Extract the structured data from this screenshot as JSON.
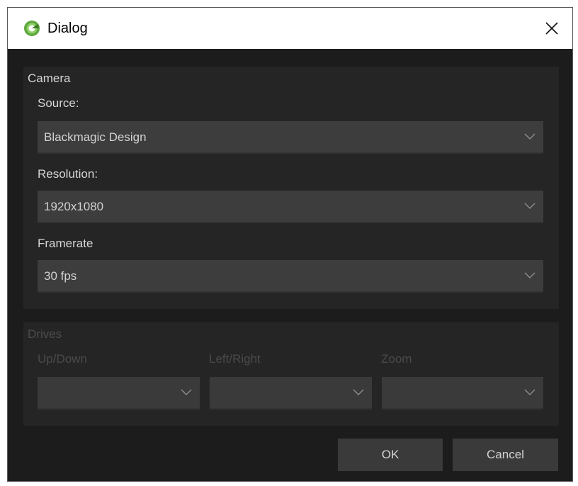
{
  "window": {
    "title": "Dialog"
  },
  "camera": {
    "group_title": "Camera",
    "source": {
      "label": "Source:",
      "value": "Blackmagic Design"
    },
    "resolution": {
      "label": "Resolution:",
      "value": "1920x1080"
    },
    "framerate": {
      "label": "Framerate",
      "value": "30 fps"
    }
  },
  "drives": {
    "group_title": "Drives",
    "up_down": {
      "label": "Up/Down",
      "value": ""
    },
    "left_right": {
      "label": "Left/Right",
      "value": ""
    },
    "zoom": {
      "label": "Zoom",
      "value": ""
    }
  },
  "buttons": {
    "ok": "OK",
    "cancel": "Cancel"
  },
  "colors": {
    "background": "#1c1c1c",
    "group_bg": "#252525",
    "combo_bg": "#3d3d3d",
    "text": "#d6d6d6",
    "disabled_text": "#4a4a4a",
    "icon_green": "#6ab04c"
  },
  "icons": {
    "app": "app-logo-icon",
    "close": "close-icon",
    "dropdown": "chevron-down-icon"
  }
}
